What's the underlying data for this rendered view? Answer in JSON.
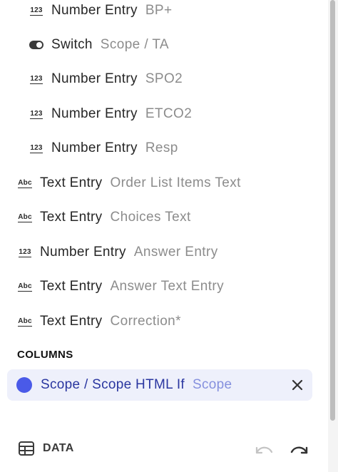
{
  "fields": [
    {
      "icon": "number-icon",
      "icon_text": "123",
      "type": "Number Entry",
      "label": "BP+"
    },
    {
      "icon": "toggle-icon",
      "icon_text": "",
      "type": "Switch",
      "label": "Scope / TA"
    },
    {
      "icon": "number-icon",
      "icon_text": "123",
      "type": "Number Entry",
      "label": "SPO2"
    },
    {
      "icon": "number-icon",
      "icon_text": "123",
      "type": "Number Entry",
      "label": "ETCO2"
    },
    {
      "icon": "number-icon",
      "icon_text": "123",
      "type": "Number Entry",
      "label": "Resp"
    },
    {
      "icon": "text-icon",
      "icon_text": "Abc",
      "type": "Text Entry",
      "label": "Order List Items Text"
    },
    {
      "icon": "text-icon",
      "icon_text": "Abc",
      "type": "Text Entry",
      "label": "Choices Text"
    },
    {
      "icon": "number-icon",
      "icon_text": "123",
      "type": "Number Entry",
      "label": "Answer Entry"
    },
    {
      "icon": "text-icon",
      "icon_text": "Abc",
      "type": "Text Entry",
      "label": "Answer Text Entry"
    },
    {
      "icon": "text-icon",
      "icon_text": "Abc",
      "type": "Text Entry",
      "label": "Correction*"
    }
  ],
  "columns_section": {
    "title": "COLUMNS",
    "items": [
      {
        "name": "Scope / Scope HTML If",
        "sub": "Scope",
        "color": "#4a5ae8"
      }
    ]
  },
  "footer": {
    "data_label": "DATA",
    "icons": [
      "table-icon",
      "undo-icon",
      "redo-icon"
    ]
  },
  "colors": {
    "accent": "#4a5ae8",
    "chip_background": "#eef0fb",
    "muted_text": "#8c8c8c"
  }
}
